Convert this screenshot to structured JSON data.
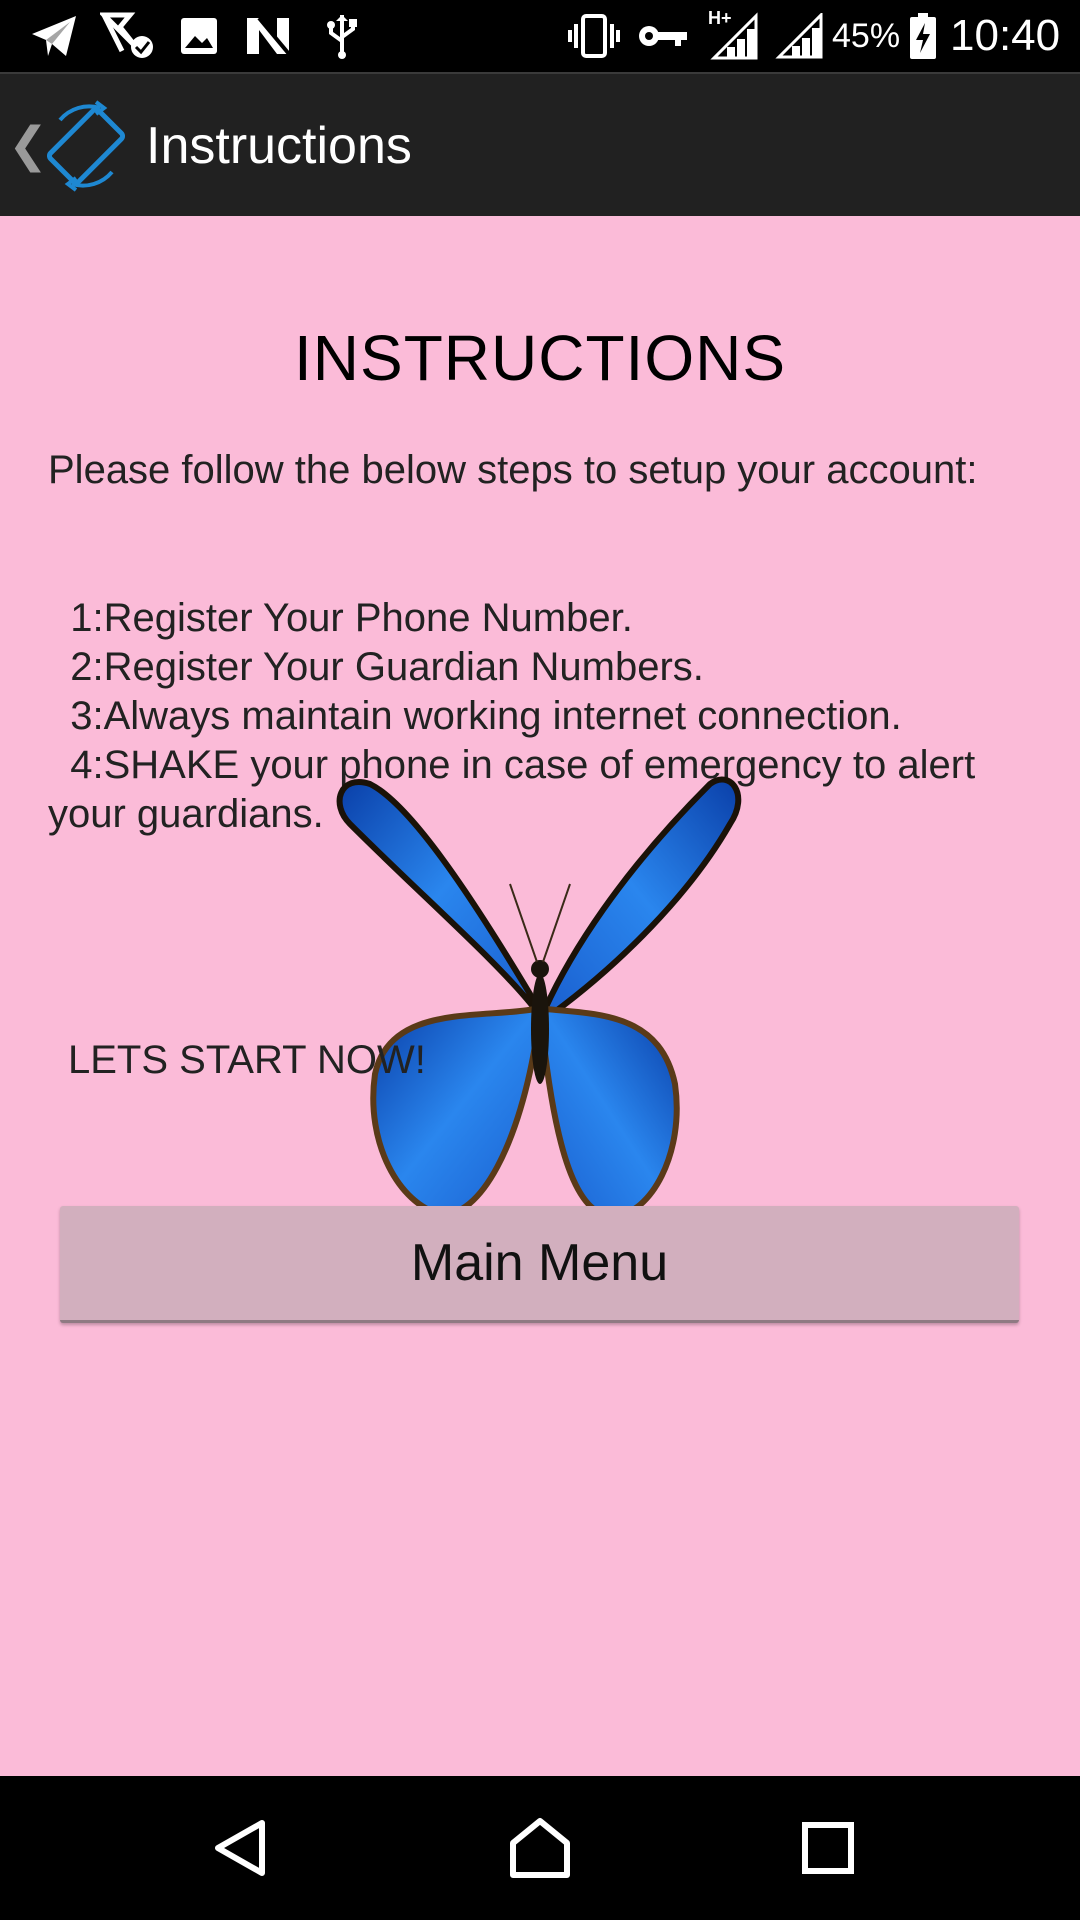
{
  "status_bar": {
    "left_icons": [
      "telegram-icon",
      "signal-check-icon",
      "image-icon",
      "n-logo-icon",
      "usb-icon"
    ],
    "right_icons": [
      "vibrate-icon",
      "key-icon",
      "hplus-signal-icon",
      "cell-signal-icon",
      "battery-charging-icon"
    ],
    "network_label": "H+",
    "battery_percent": "45%",
    "time": "10:40"
  },
  "action_bar": {
    "title": "Instructions",
    "app_icon": "screen-rotation-icon",
    "up_icon": "back-caret-icon"
  },
  "content": {
    "heading": "INSTRUCTIONS",
    "intro": "Please follow the below steps to setup your account:",
    "steps": [
      "  1:Register Your Phone Number.",
      "  2:Register Your Guardian Numbers.",
      "  3:Always maintain working internet connection.",
      "  4:SHAKE your phone in case of emergency to alert your guardians."
    ],
    "lets_start": "LETS START NOW!",
    "decoration": "butterfly-image"
  },
  "main_menu_button": {
    "label": "Main Menu"
  },
  "nav_bar": {
    "back": "back-triangle-icon",
    "home": "home-icon",
    "recents": "recents-square-icon"
  },
  "colors": {
    "background": "#fbbbd8",
    "action_bar": "#212121",
    "status_bar": "#000000",
    "button": "#d2afbe",
    "accent": "#1e88d2",
    "butterfly_blue": "#1f6fe0"
  }
}
